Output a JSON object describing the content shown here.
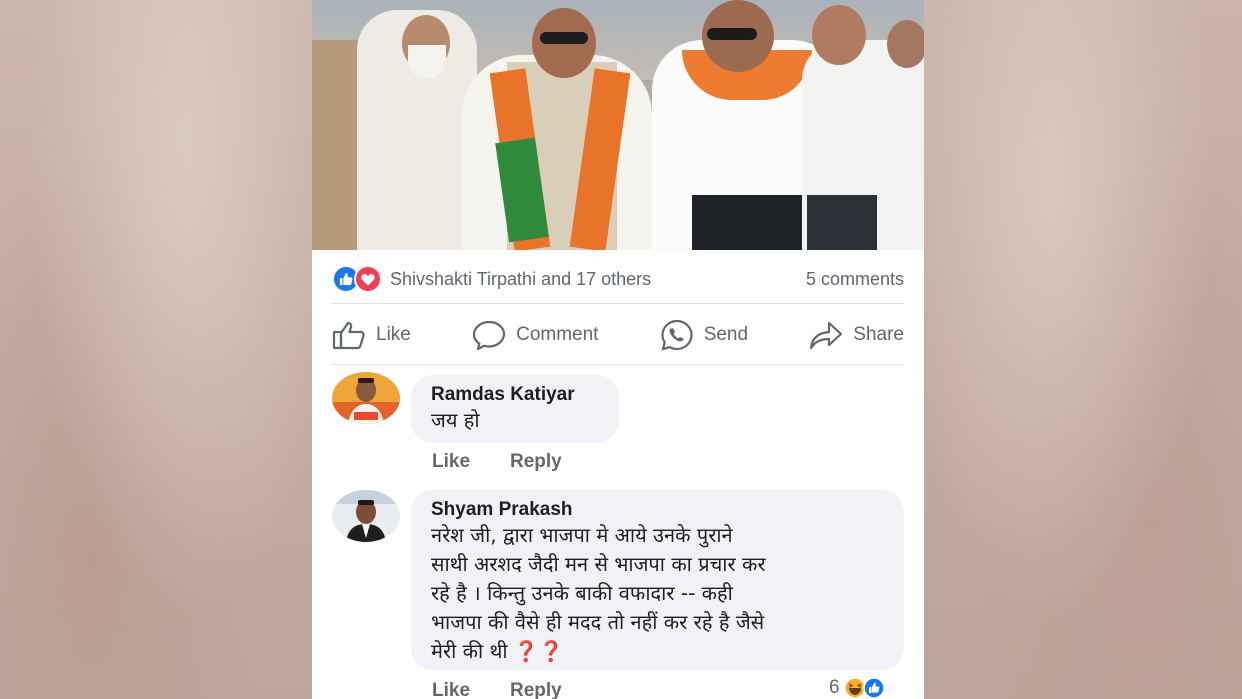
{
  "post": {
    "reactions": {
      "names": "Shivshakti Tirpathi and 17 others",
      "comments": "5 comments"
    },
    "actions": {
      "like": "Like",
      "comment": "Comment",
      "send": "Send",
      "share": "Share"
    },
    "comments": [
      {
        "author": "Ramdas Katiyar",
        "text": "जय हो",
        "like": "Like",
        "reply": "Reply"
      },
      {
        "author": "Shyam Prakash",
        "lines": [
          "नरेश जी, द्वारा भाजपा मे आये उनके पुराने",
          "साथी अरशद जैदी मन से भाजपा का प्रचार कर",
          "रहे है । किन्तु उनके बाकी वफादार -- कही",
          "भाजपा की वैसे ही मदद तो नहीं कर रहे है जैसे",
          "मेरी की थी"
        ],
        "suffix": "❓❓",
        "like": "Like",
        "reply": "Reply",
        "reaction_count": "6"
      }
    ]
  },
  "colors": {
    "fb_blue": "#1877f2",
    "love_red": "#f33e58",
    "bubble_bg": "#f0f2f5"
  }
}
